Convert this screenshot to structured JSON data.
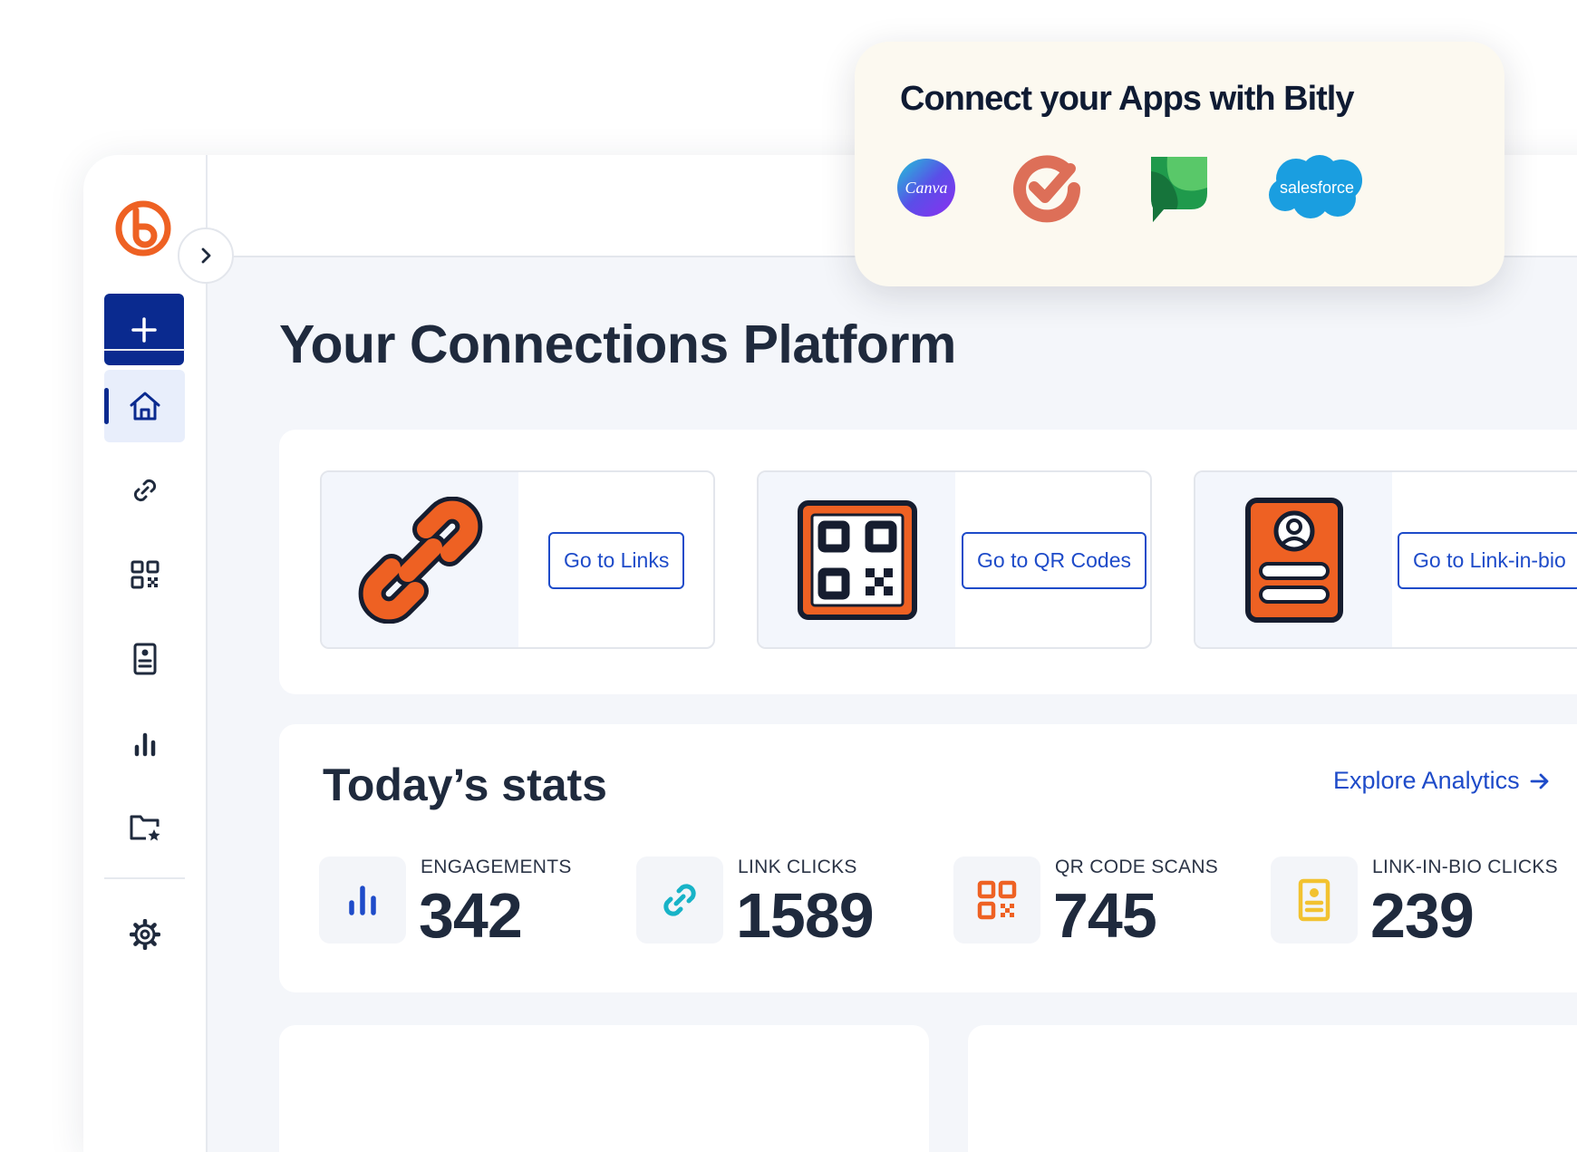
{
  "nav": {
    "create_label": "+",
    "items": [
      "home",
      "links",
      "qr-codes",
      "link-in-bio",
      "analytics",
      "campaigns",
      "settings"
    ]
  },
  "page": {
    "title": "Your Connections Platform"
  },
  "shortcuts": [
    {
      "button": "Go to Links",
      "icon": "chain-link-illustration"
    },
    {
      "button": "Go to QR Codes",
      "icon": "qr-code-illustration"
    },
    {
      "button": "Go to Link-in-bio",
      "icon": "profile-page-illustration"
    }
  ],
  "stats": {
    "title": "Today’s stats",
    "explore_label": "Explore Analytics",
    "items": [
      {
        "label": "ENGAGEMENTS",
        "value": "342",
        "icon": "bar-chart-icon",
        "color": "#1e4bc9"
      },
      {
        "label": "LINK CLICKS",
        "value": "1589",
        "icon": "link-icon",
        "color": "#17b3c7"
      },
      {
        "label": "QR CODE SCANS",
        "value": "745",
        "icon": "qr-icon",
        "color": "#ee6123"
      },
      {
        "label": "LINK-IN-BIO CLICKS",
        "value": "239",
        "icon": "page-icon",
        "color": "#f2c230"
      }
    ]
  },
  "integrations": {
    "title": "Connect your Apps with Bitly",
    "apps": [
      {
        "name": "Canva",
        "label": "Canva"
      },
      {
        "name": "Todoist",
        "label": ""
      },
      {
        "name": "Sprout Social",
        "label": ""
      },
      {
        "name": "Salesforce",
        "label": "salesforce"
      }
    ]
  },
  "colors": {
    "brand_orange": "#ee6123",
    "primary_blue": "#0a2a8f",
    "link_blue": "#1e4bc9",
    "text_dark": "#1f2a3d"
  }
}
